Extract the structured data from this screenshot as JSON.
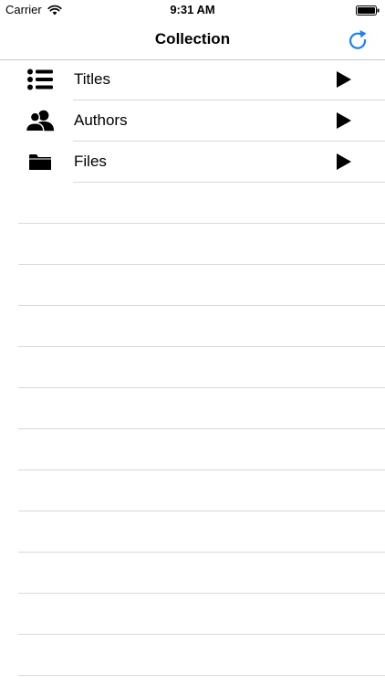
{
  "status_bar": {
    "carrier": "Carrier",
    "time": "9:31 AM"
  },
  "nav": {
    "title": "Collection",
    "refresh_icon": "refresh-icon"
  },
  "colors": {
    "accent": "#1a82f7",
    "separator": "#d9d9dd",
    "nav_border": "#c8c7cc"
  },
  "list": {
    "items": [
      {
        "label": "Titles",
        "icon": "list-icon"
      },
      {
        "label": "Authors",
        "icon": "people-icon"
      },
      {
        "label": "Files",
        "icon": "folder-icon"
      }
    ]
  }
}
